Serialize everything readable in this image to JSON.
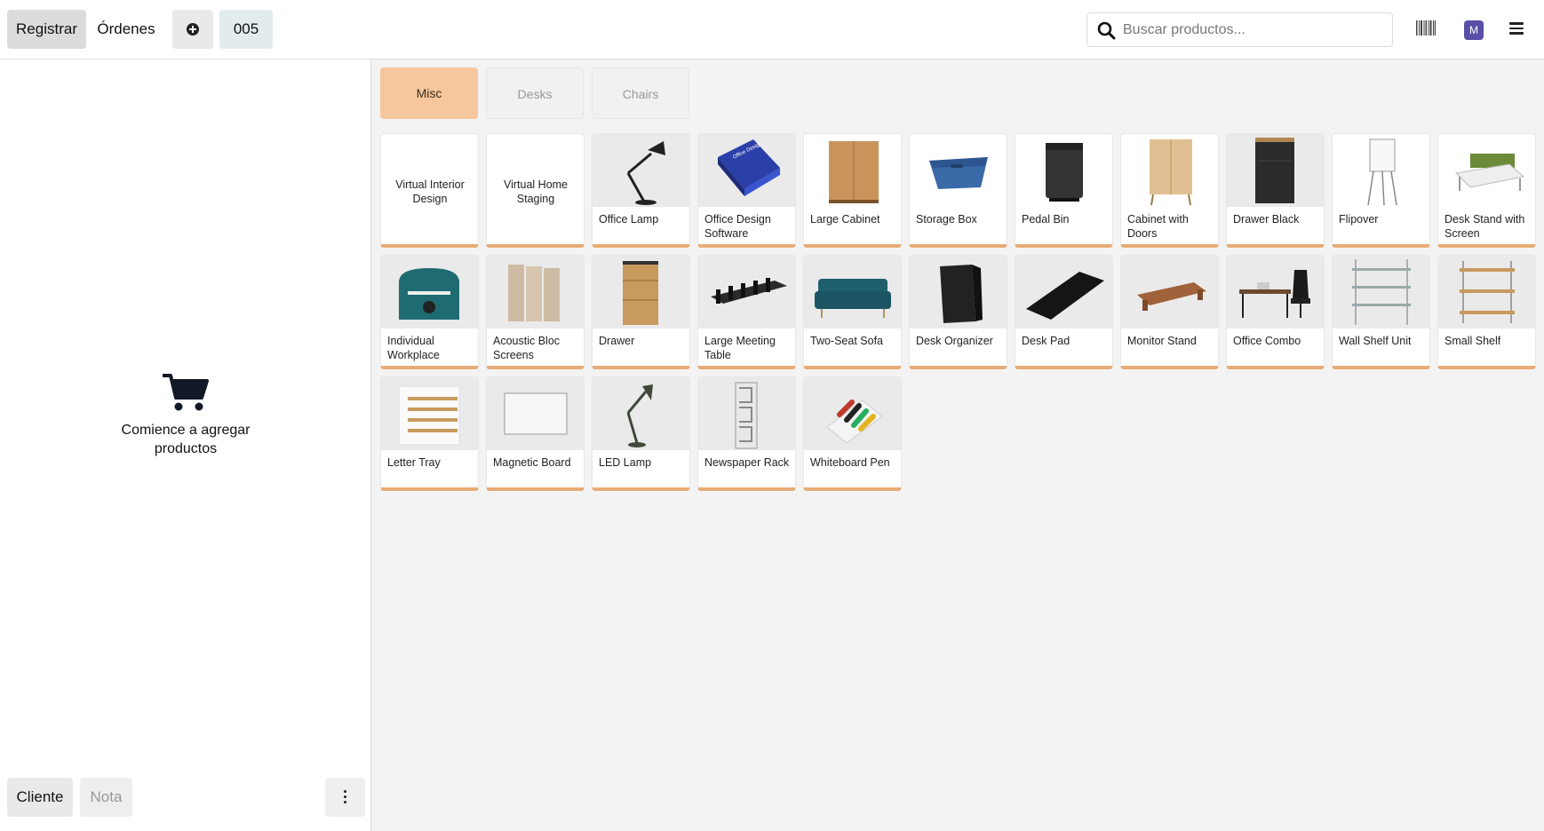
{
  "topbar": {
    "register_label": "Registrar",
    "orders_label": "Órdenes",
    "order_number": "005",
    "search_placeholder": "Buscar productos...",
    "avatar_initial": "M"
  },
  "cart": {
    "empty_message": "Comience a agregar productos",
    "customer_label": "Cliente",
    "note_label": "Nota"
  },
  "categories": [
    {
      "label": "Misc",
      "active": true
    },
    {
      "label": "Desks",
      "active": false
    },
    {
      "label": "Chairs",
      "active": false
    }
  ],
  "products": [
    {
      "name": "Virtual Interior Design",
      "image": "none"
    },
    {
      "name": "Virtual Home Staging",
      "image": "none"
    },
    {
      "name": "Office Lamp",
      "image": "desk-lamp"
    },
    {
      "name": "Office Design Software",
      "image": "software-box"
    },
    {
      "name": "Large Cabinet",
      "image": "wood-cabinet"
    },
    {
      "name": "Storage Box",
      "image": "blue-box"
    },
    {
      "name": "Pedal Bin",
      "image": "bin"
    },
    {
      "name": "Cabinet with Doors",
      "image": "tall-cabinet"
    },
    {
      "name": "Drawer Black",
      "image": "black-drawer"
    },
    {
      "name": "Flipover",
      "image": "flipchart"
    },
    {
      "name": "Desk Stand with Screen",
      "image": "desk-screen"
    },
    {
      "name": "Individual Workplace",
      "image": "pod"
    },
    {
      "name": "Acoustic Bloc Screens",
      "image": "screens"
    },
    {
      "name": "Drawer",
      "image": "drawer"
    },
    {
      "name": "Large Meeting Table",
      "image": "meeting-table"
    },
    {
      "name": "Two-Seat Sofa",
      "image": "sofa"
    },
    {
      "name": "Desk Organizer",
      "image": "organizer"
    },
    {
      "name": "Desk Pad",
      "image": "desk-pad"
    },
    {
      "name": "Monitor Stand",
      "image": "monitor-stand"
    },
    {
      "name": "Office Combo",
      "image": "office-combo"
    },
    {
      "name": "Wall Shelf Unit",
      "image": "wall-shelf"
    },
    {
      "name": "Small Shelf",
      "image": "small-shelf"
    },
    {
      "name": "Letter Tray",
      "image": "letter-tray"
    },
    {
      "name": "Magnetic Board",
      "image": "board"
    },
    {
      "name": "LED Lamp",
      "image": "led-lamp"
    },
    {
      "name": "Newspaper Rack",
      "image": "rack"
    },
    {
      "name": "Whiteboard Pen",
      "image": "pens"
    }
  ],
  "colors": {
    "active_category": "#f6c79c",
    "card_accent": "#e8ac76",
    "avatar": "#5a4fa8"
  }
}
